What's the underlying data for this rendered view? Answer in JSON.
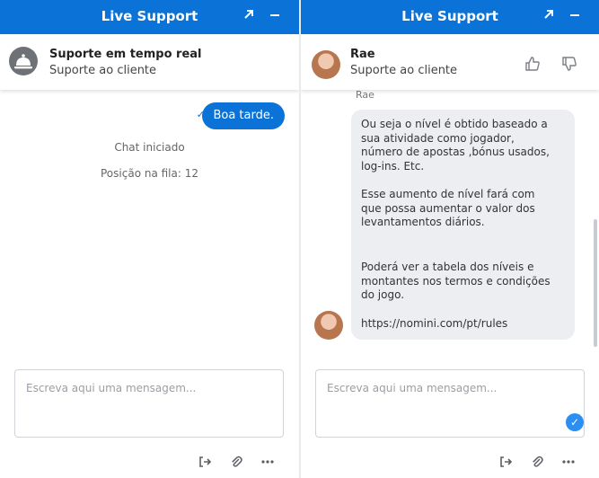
{
  "left": {
    "titlebar": {
      "title": "Live Support"
    },
    "header": {
      "title": "Suporte em tempo real",
      "subtitle": "Suporte ao cliente"
    },
    "messages": {
      "outgoing": "Boa tarde.",
      "system": [
        "Chat iniciado",
        "Posição na fila: 12"
      ]
    },
    "composer": {
      "placeholder": "Escreva aqui uma mensagem..."
    }
  },
  "right": {
    "titlebar": {
      "title": "Live Support"
    },
    "header": {
      "name": "Rae",
      "subtitle": "Suporte ao cliente"
    },
    "sender_label": "Rae",
    "message": {
      "p1": "Ou seja o nível é obtido baseado a sua atividade como jogador, número de apostas ,bónus usados, log-ins. Etc.",
      "p2": "Esse aumento de nível fará com que possa aumentar o valor dos levantamentos diários.",
      "p3": "Poderá ver a tabela dos níveis e montantes nos termos e condições do jogo.",
      "link": "https://nomini.com/pt/rules"
    },
    "composer": {
      "placeholder": "Escreva aqui uma mensagem..."
    }
  },
  "icons": {
    "expand": "expand-icon",
    "minimize": "minimize-icon",
    "bell": "concierge-bell-icon",
    "thumbs_up": "thumbs-up-icon",
    "thumbs_down": "thumbs-down-icon",
    "exit": "exit-icon",
    "attach": "paperclip-icon",
    "more": "more-icon",
    "send": "send-icon"
  },
  "colors": {
    "brand": "#0b73d8",
    "incoming_bubble": "#eceef1"
  }
}
